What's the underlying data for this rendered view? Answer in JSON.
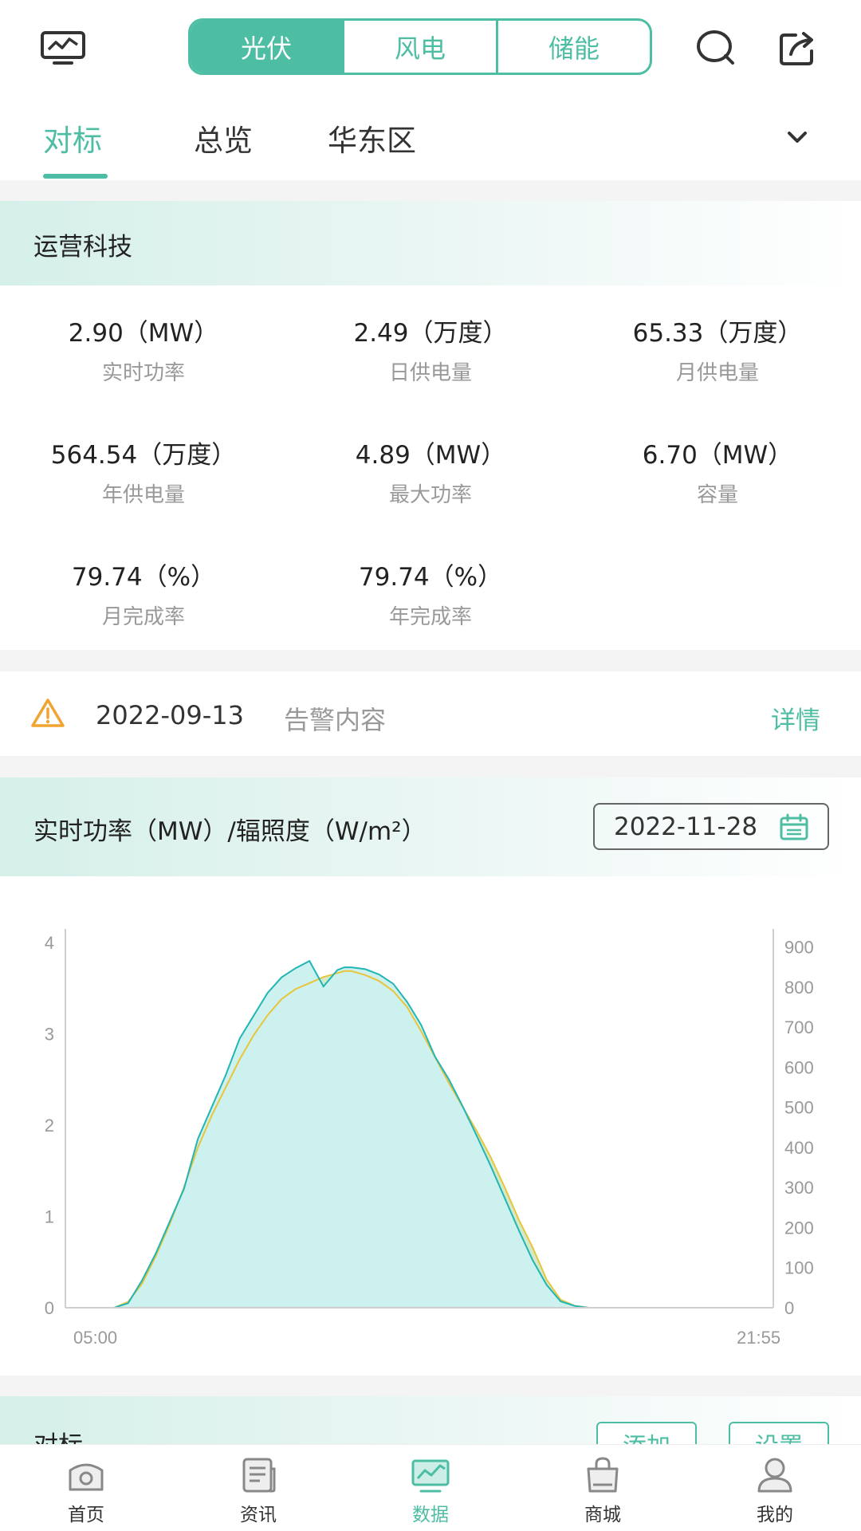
{
  "header": {
    "segments": [
      {
        "label": "光伏",
        "active": true
      },
      {
        "label": "风电",
        "active": false
      },
      {
        "label": "储能",
        "active": false
      }
    ],
    "icons": {
      "left": "monitor-chart-icon",
      "search": "search-icon",
      "share": "share-icon"
    }
  },
  "tabs": [
    {
      "label": "对标",
      "active": true
    },
    {
      "label": "总览",
      "active": false
    },
    {
      "label": "华东区",
      "active": false
    }
  ],
  "station": {
    "name": "运营科技",
    "metrics": [
      {
        "value": "2.90（MW）",
        "label": "实时功率"
      },
      {
        "value": "2.49（万度）",
        "label": "日供电量"
      },
      {
        "value": "65.33（万度）",
        "label": "月供电量"
      },
      {
        "value": "564.54（万度）",
        "label": "年供电量"
      },
      {
        "value": "4.89（MW）",
        "label": "最大功率"
      },
      {
        "value": "6.70（MW）",
        "label": "容量"
      },
      {
        "value": "79.74（%）",
        "label": "月完成率"
      },
      {
        "value": "79.74（%）",
        "label": "年完成率"
      }
    ]
  },
  "alarm": {
    "date": "2022-09-13",
    "content": "告警内容",
    "detail_label": "详情",
    "icon": "warning-icon"
  },
  "chart_section": {
    "title": "实时功率（MW）/辐照度（W/m²）",
    "date": "2022-11-28"
  },
  "chart_data": {
    "type": "area",
    "x_start": "05:00",
    "x_end": "21:55",
    "x_labels": [
      "05:00",
      "21:55"
    ],
    "y_left": {
      "ticks": [
        0,
        1,
        2,
        3,
        4
      ],
      "lim": [
        0,
        4.15
      ]
    },
    "y_right": {
      "ticks": [
        0,
        100,
        200,
        300,
        400,
        500,
        600,
        700,
        800,
        900
      ],
      "lim": [
        0,
        945
      ]
    },
    "colors": {
      "power_line": "#22b5b5",
      "power_fill": "#cdf1ef",
      "irradiance_line": "#e8c53c",
      "irradiance_fill": "#d2eaca"
    },
    "series": [
      {
        "axis": "left",
        "times": [
          "05:00",
          "06:10",
          "06:30",
          "06:50",
          "07:10",
          "07:30",
          "07:50",
          "08:10",
          "08:30",
          "08:50",
          "09:10",
          "09:30",
          "09:50",
          "10:10",
          "10:30",
          "10:50",
          "11:10",
          "11:30",
          "11:40",
          "11:50",
          "12:10",
          "12:30",
          "12:50",
          "13:10",
          "13:30",
          "13:50",
          "14:10",
          "14:30",
          "14:50",
          "15:10",
          "15:30",
          "15:50",
          "16:10",
          "16:30",
          "16:50",
          "17:10",
          "17:30",
          "17:40",
          "18:00",
          "21:55"
        ],
        "values": [
          0,
          0,
          0.05,
          0.3,
          0.6,
          0.95,
          1.3,
          1.85,
          2.2,
          2.55,
          2.95,
          3.2,
          3.45,
          3.62,
          3.72,
          3.8,
          3.52,
          3.7,
          3.73,
          3.73,
          3.71,
          3.65,
          3.55,
          3.35,
          3.1,
          2.75,
          2.5,
          2.2,
          1.88,
          1.55,
          1.2,
          0.85,
          0.52,
          0.25,
          0.07,
          0.02,
          0,
          0,
          0,
          0
        ]
      },
      {
        "axis": "right",
        "times": [
          "05:00",
          "06:10",
          "06:30",
          "06:50",
          "07:10",
          "07:30",
          "07:50",
          "08:10",
          "08:30",
          "08:50",
          "09:10",
          "09:30",
          "09:50",
          "10:10",
          "10:30",
          "10:50",
          "11:10",
          "11:30",
          "11:40",
          "11:50",
          "12:10",
          "12:30",
          "12:50",
          "13:10",
          "13:30",
          "13:50",
          "14:10",
          "14:30",
          "14:50",
          "15:10",
          "15:30",
          "15:50",
          "16:10",
          "16:30",
          "16:50",
          "17:10",
          "17:30",
          "17:40",
          "18:00",
          "21:55"
        ],
        "values": [
          0,
          0,
          15,
          60,
          130,
          210,
          300,
          400,
          480,
          550,
          620,
          680,
          730,
          770,
          795,
          810,
          825,
          835,
          840,
          840,
          830,
          815,
          790,
          750,
          690,
          625,
          560,
          500,
          440,
          375,
          300,
          220,
          150,
          70,
          20,
          5,
          0,
          0,
          0,
          0
        ]
      }
    ]
  },
  "benchmark": {
    "title": "对标",
    "add_label": "添加",
    "settings_label": "设置"
  },
  "nav": [
    {
      "label": "首页",
      "icon": "home-icon",
      "active": false
    },
    {
      "label": "资讯",
      "icon": "news-icon",
      "active": false
    },
    {
      "label": "数据",
      "icon": "data-chart-icon",
      "active": true
    },
    {
      "label": "商城",
      "icon": "shopping-bag-icon",
      "active": false
    },
    {
      "label": "我的",
      "icon": "user-icon",
      "active": false
    }
  ]
}
